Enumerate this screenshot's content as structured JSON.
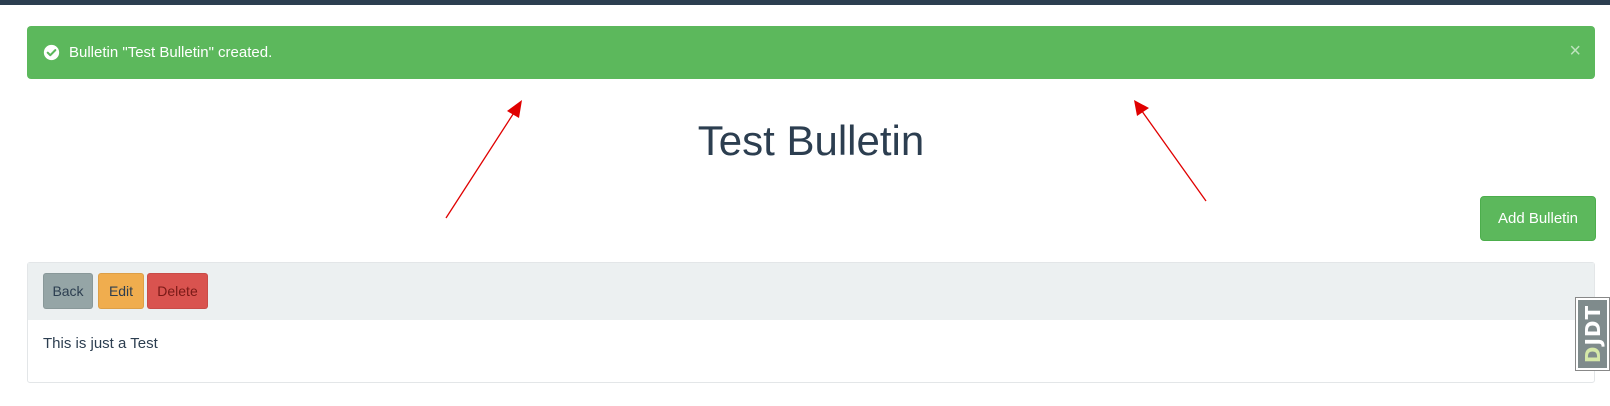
{
  "colors": {
    "success": "#5cb85c",
    "header_dark": "#2c3e50",
    "warning": "#f0ad4e",
    "danger": "#d9534f",
    "neutral": "#95a5a6",
    "annotation_arrow": "#e00000"
  },
  "alert": {
    "icon": "check-circle-icon",
    "message": "Bulletin \"Test Bulletin\" created.",
    "close_glyph": "×"
  },
  "page": {
    "title": "Test Bulletin"
  },
  "actions": {
    "add_label": "Add Bulletin"
  },
  "bulletin": {
    "buttons": {
      "back": "Back",
      "edit": "Edit",
      "delete": "Delete"
    },
    "body": "This is just a Test"
  },
  "debug_toolbar": {
    "first": "D",
    "rest": "JDT"
  }
}
